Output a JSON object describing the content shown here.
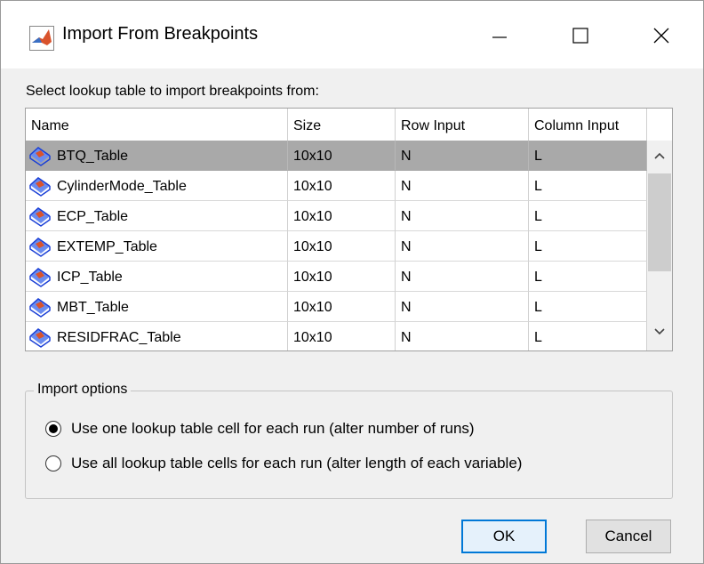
{
  "window": {
    "title": "Import From Breakpoints"
  },
  "caption": "Select lookup table to import breakpoints from:",
  "table": {
    "columns": [
      "Name",
      "Size",
      "Row Input",
      "Column Input"
    ],
    "rows": [
      {
        "name": "BTQ_Table",
        "size": "10x10",
        "row_input": "N",
        "column_input": "L"
      },
      {
        "name": "CylinderMode_Table",
        "size": "10x10",
        "row_input": "N",
        "column_input": "L"
      },
      {
        "name": "ECP_Table",
        "size": "10x10",
        "row_input": "N",
        "column_input": "L"
      },
      {
        "name": "EXTEMP_Table",
        "size": "10x10",
        "row_input": "N",
        "column_input": "L"
      },
      {
        "name": "ICP_Table",
        "size": "10x10",
        "row_input": "N",
        "column_input": "L"
      },
      {
        "name": "MBT_Table",
        "size": "10x10",
        "row_input": "N",
        "column_input": "L"
      },
      {
        "name": "RESIDFRAC_Table",
        "size": "10x10",
        "row_input": "N",
        "column_input": "L"
      }
    ],
    "selected_row": "BTQ_Table"
  },
  "import_options": {
    "legend": "Import options",
    "options": [
      {
        "label": "Use one lookup table cell for each run (alter number of runs)",
        "checked": true
      },
      {
        "label": "Use all lookup table cells for each run (alter length of each variable)",
        "checked": false
      }
    ]
  },
  "buttons": {
    "ok": "OK",
    "cancel": "Cancel"
  },
  "colors": {
    "selection": "#a9a9a9",
    "accent": "#0078d7",
    "matlab_orange": "#d9532c",
    "table_icon_blue": "#1a3fd6"
  }
}
